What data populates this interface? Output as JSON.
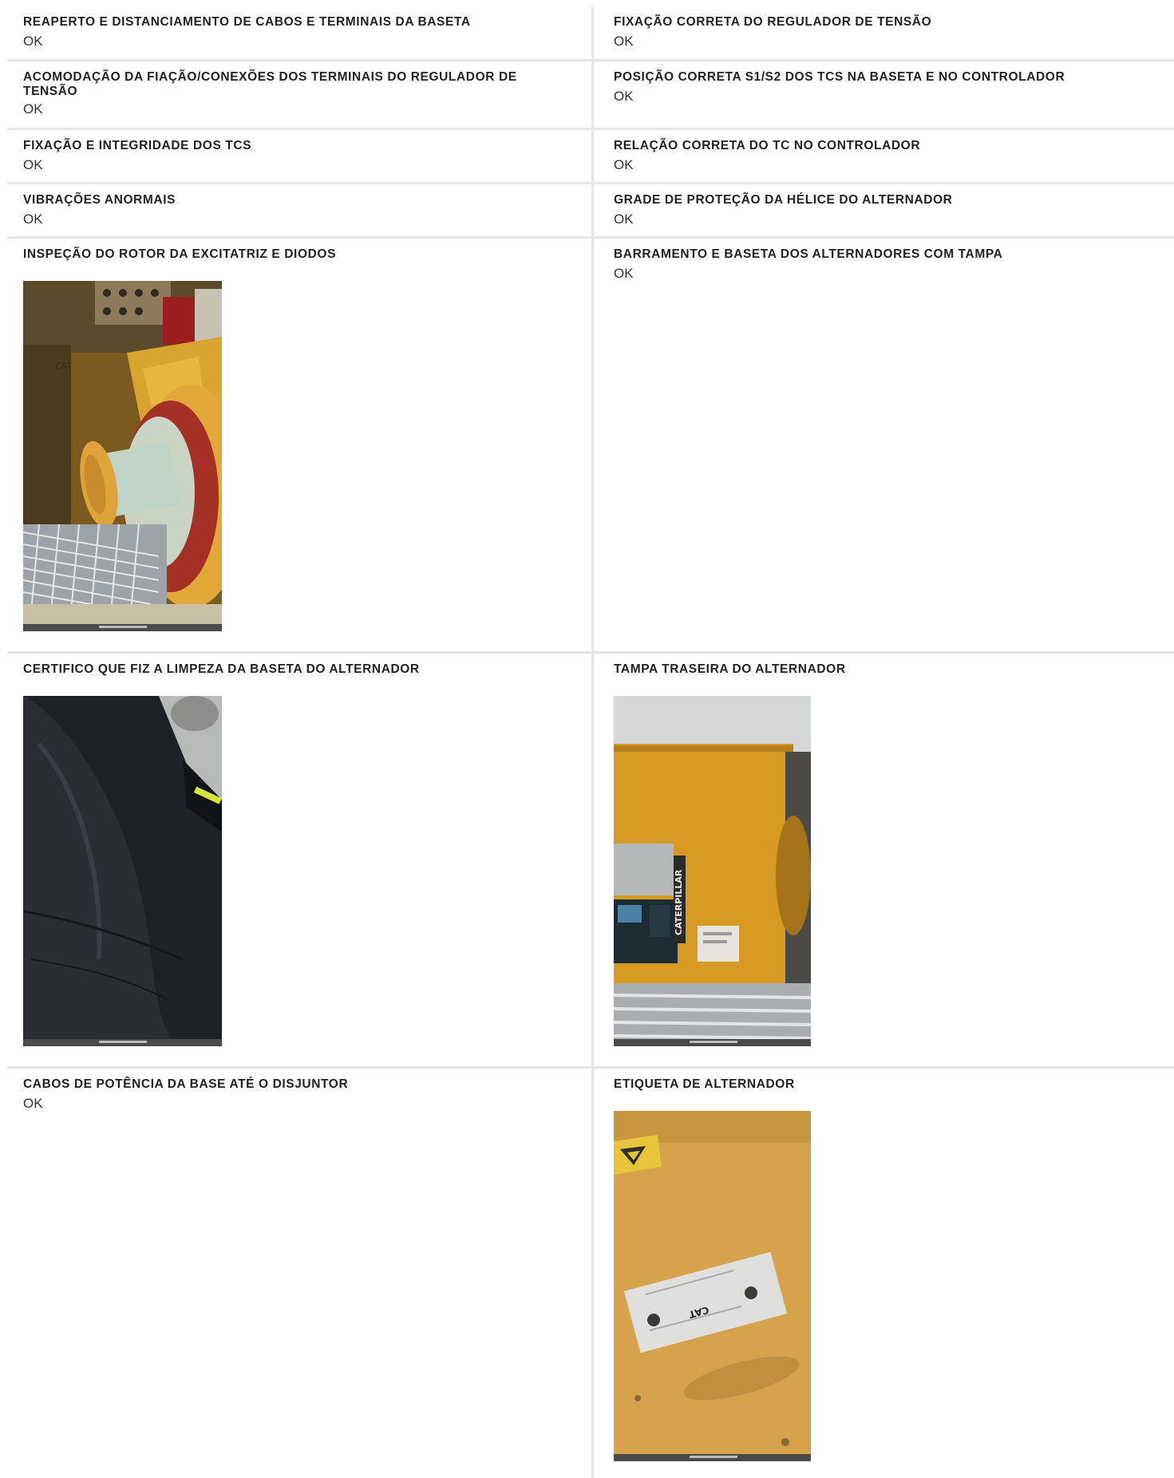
{
  "rows": [
    {
      "left": {
        "label": "REAPERTO E DISTANCIAMENTO DE CABOS E TERMINAIS DA BASETA",
        "value": "OK"
      },
      "right": {
        "label": "FIXAÇÃO CORRETA DO REGULADOR DE TENSÃO",
        "value": "OK"
      }
    },
    {
      "left": {
        "label": "ACOMODAÇÃO DA FIAÇÃO/CONEXÕES DOS TERMINAIS DO REGULADOR DE TENSÃO",
        "value": "OK"
      },
      "right": {
        "label": "POSIÇÃO CORRETA S1/S2 DOS TCS NA BASETA E NO CONTROLADOR",
        "value": "OK"
      }
    },
    {
      "left": {
        "label": "FIXAÇÃO E INTEGRIDADE DOS TCS",
        "value": "OK"
      },
      "right": {
        "label": "RELAÇÃO CORRETA DO TC NO CONTROLADOR",
        "value": "OK"
      }
    },
    {
      "left": {
        "label": "VIBRAÇÕES ANORMAIS",
        "value": "OK"
      },
      "right": {
        "label": "GRADE DE PROTEÇÃO DA HÉLICE DO ALTERNADOR",
        "value": "OK"
      }
    },
    {
      "left": {
        "label": "INSPEÇÃO DO ROTOR DA EXCITATRIZ E DIODOS"
      },
      "right": {
        "label": "BARRAMENTO E BASETA DOS ALTERNADORES COM TAMPA",
        "value": "OK"
      }
    },
    {
      "left": {
        "label": "CERTIFICO QUE FIZ A LIMPEZA DA BASETA DO ALTERNADOR"
      },
      "right": {
        "label": "TAMPA TRASEIRA DO ALTERNADOR"
      }
    },
    {
      "left": {
        "label": "CABOS DE POTÊNCIA DA BASE ATÉ O DISJUNTOR",
        "value": "OK"
      },
      "right": {
        "label": "ETIQUETA DE ALTERNADOR"
      }
    }
  ],
  "photos": {
    "rotor": {
      "logo_text": "CAT"
    },
    "tampa": {
      "brand_text": "CATERPILLAR"
    },
    "etiqueta": {
      "brand_text": "CAT"
    }
  }
}
